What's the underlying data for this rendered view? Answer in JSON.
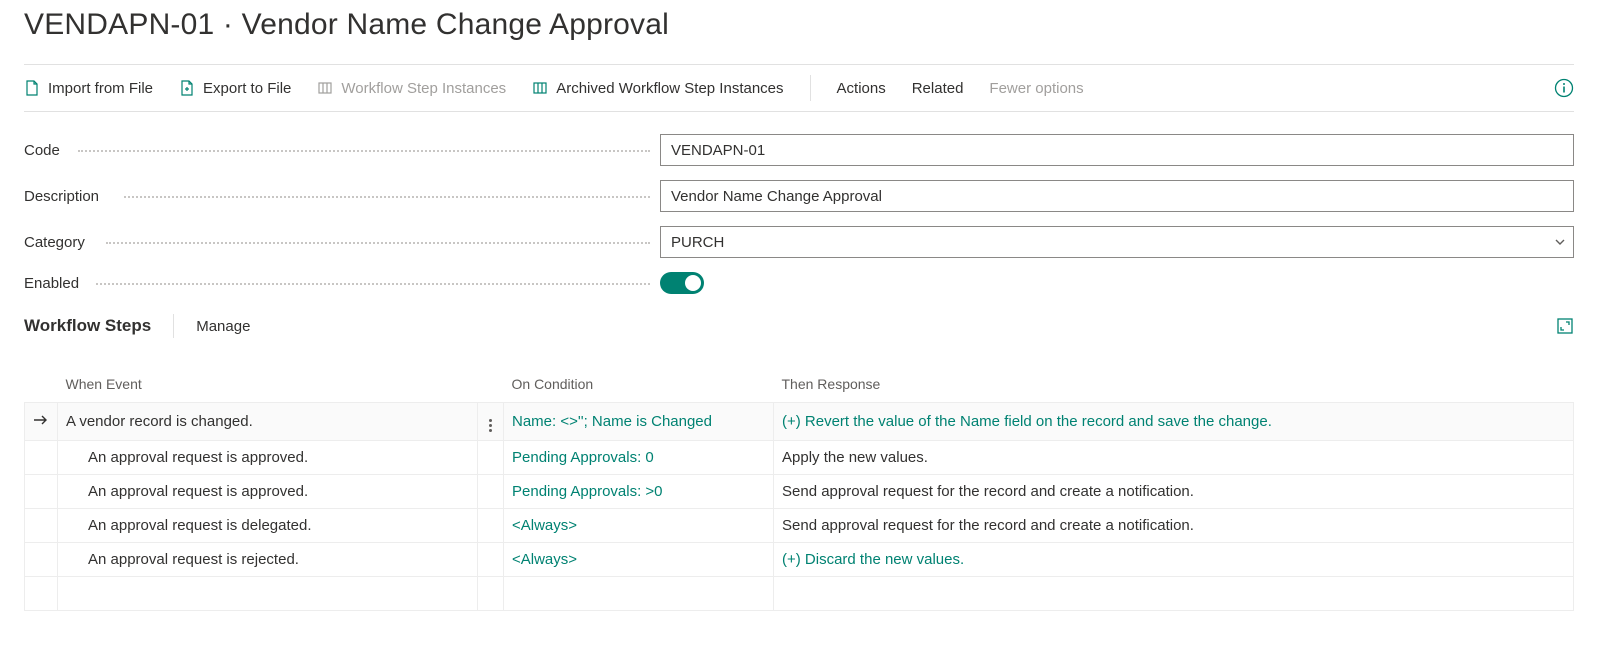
{
  "title": "VENDAPN-01 · Vendor Name Change Approval",
  "toolbar": {
    "import": "Import from File",
    "export": "Export to File",
    "step_instances": "Workflow Step Instances",
    "archived_step_instances": "Archived Workflow Step Instances",
    "actions": "Actions",
    "related": "Related",
    "fewer": "Fewer options"
  },
  "form": {
    "code_label": "Code",
    "code_value": "VENDAPN-01",
    "description_label": "Description",
    "description_value": "Vendor Name Change Approval",
    "category_label": "Category",
    "category_value": "PURCH",
    "enabled_label": "Enabled",
    "enabled_value": true
  },
  "section": {
    "title": "Workflow Steps",
    "manage": "Manage"
  },
  "table": {
    "headers": {
      "event": "When Event",
      "condition": "On Condition",
      "response": "Then Response"
    },
    "rows": [
      {
        "selected": true,
        "indent": 0,
        "event": "A vendor record is changed.",
        "condition": "Name: <>''; Name is Changed",
        "response": "(+) Revert the value of the Name field on the record and save the change.",
        "response_link": true
      },
      {
        "indent": 1,
        "event": "An approval request is approved.",
        "condition": "Pending Approvals: 0",
        "response": "Apply the new values.",
        "response_link": false
      },
      {
        "indent": 1,
        "event": "An approval request is approved.",
        "condition": "Pending Approvals: >0",
        "response": "Send approval request for the record and create a notification.",
        "response_link": false
      },
      {
        "indent": 1,
        "event": "An approval request is delegated.",
        "condition": "<Always>",
        "response": "Send approval request for the record and create a notification.",
        "response_link": false
      },
      {
        "indent": 1,
        "event": "An approval request is rejected.",
        "condition": "<Always>",
        "response": "(+) Discard the new values.",
        "response_link": true
      }
    ]
  },
  "colors": {
    "accent": "#008272"
  }
}
